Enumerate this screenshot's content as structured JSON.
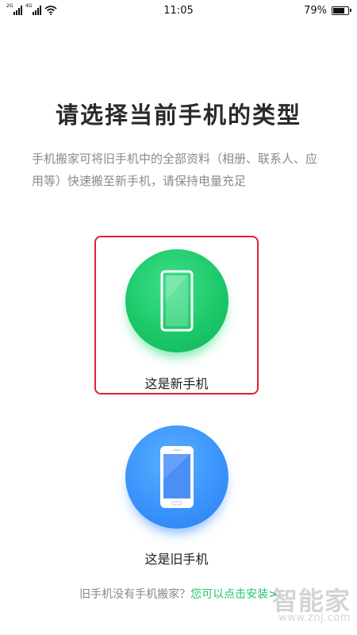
{
  "status_bar": {
    "sim1_tag": "2G",
    "sim2_tag": "4G",
    "time": "11:05",
    "battery_text": "79%",
    "battery_level": 0.79
  },
  "header": {
    "title": "请选择当前手机的类型",
    "subtitle": "手机搬家可将旧手机中的全部资料（相册、联系人、应用等）快速搬至新手机，请保持电量充足"
  },
  "options": {
    "new_phone": {
      "label": "这是新手机",
      "selected": true,
      "color": "#1cc96a"
    },
    "old_phone": {
      "label": "这是旧手机",
      "selected": false,
      "color": "#3b94fb"
    }
  },
  "footer": {
    "text": "旧手机没有手机搬家？",
    "link": "您可以点击安装>"
  },
  "watermark": {
    "brand": "智能家",
    "url": "www.znj.com"
  },
  "colors": {
    "accent_green": "#1ec46e",
    "selection_border": "#e0202e"
  }
}
